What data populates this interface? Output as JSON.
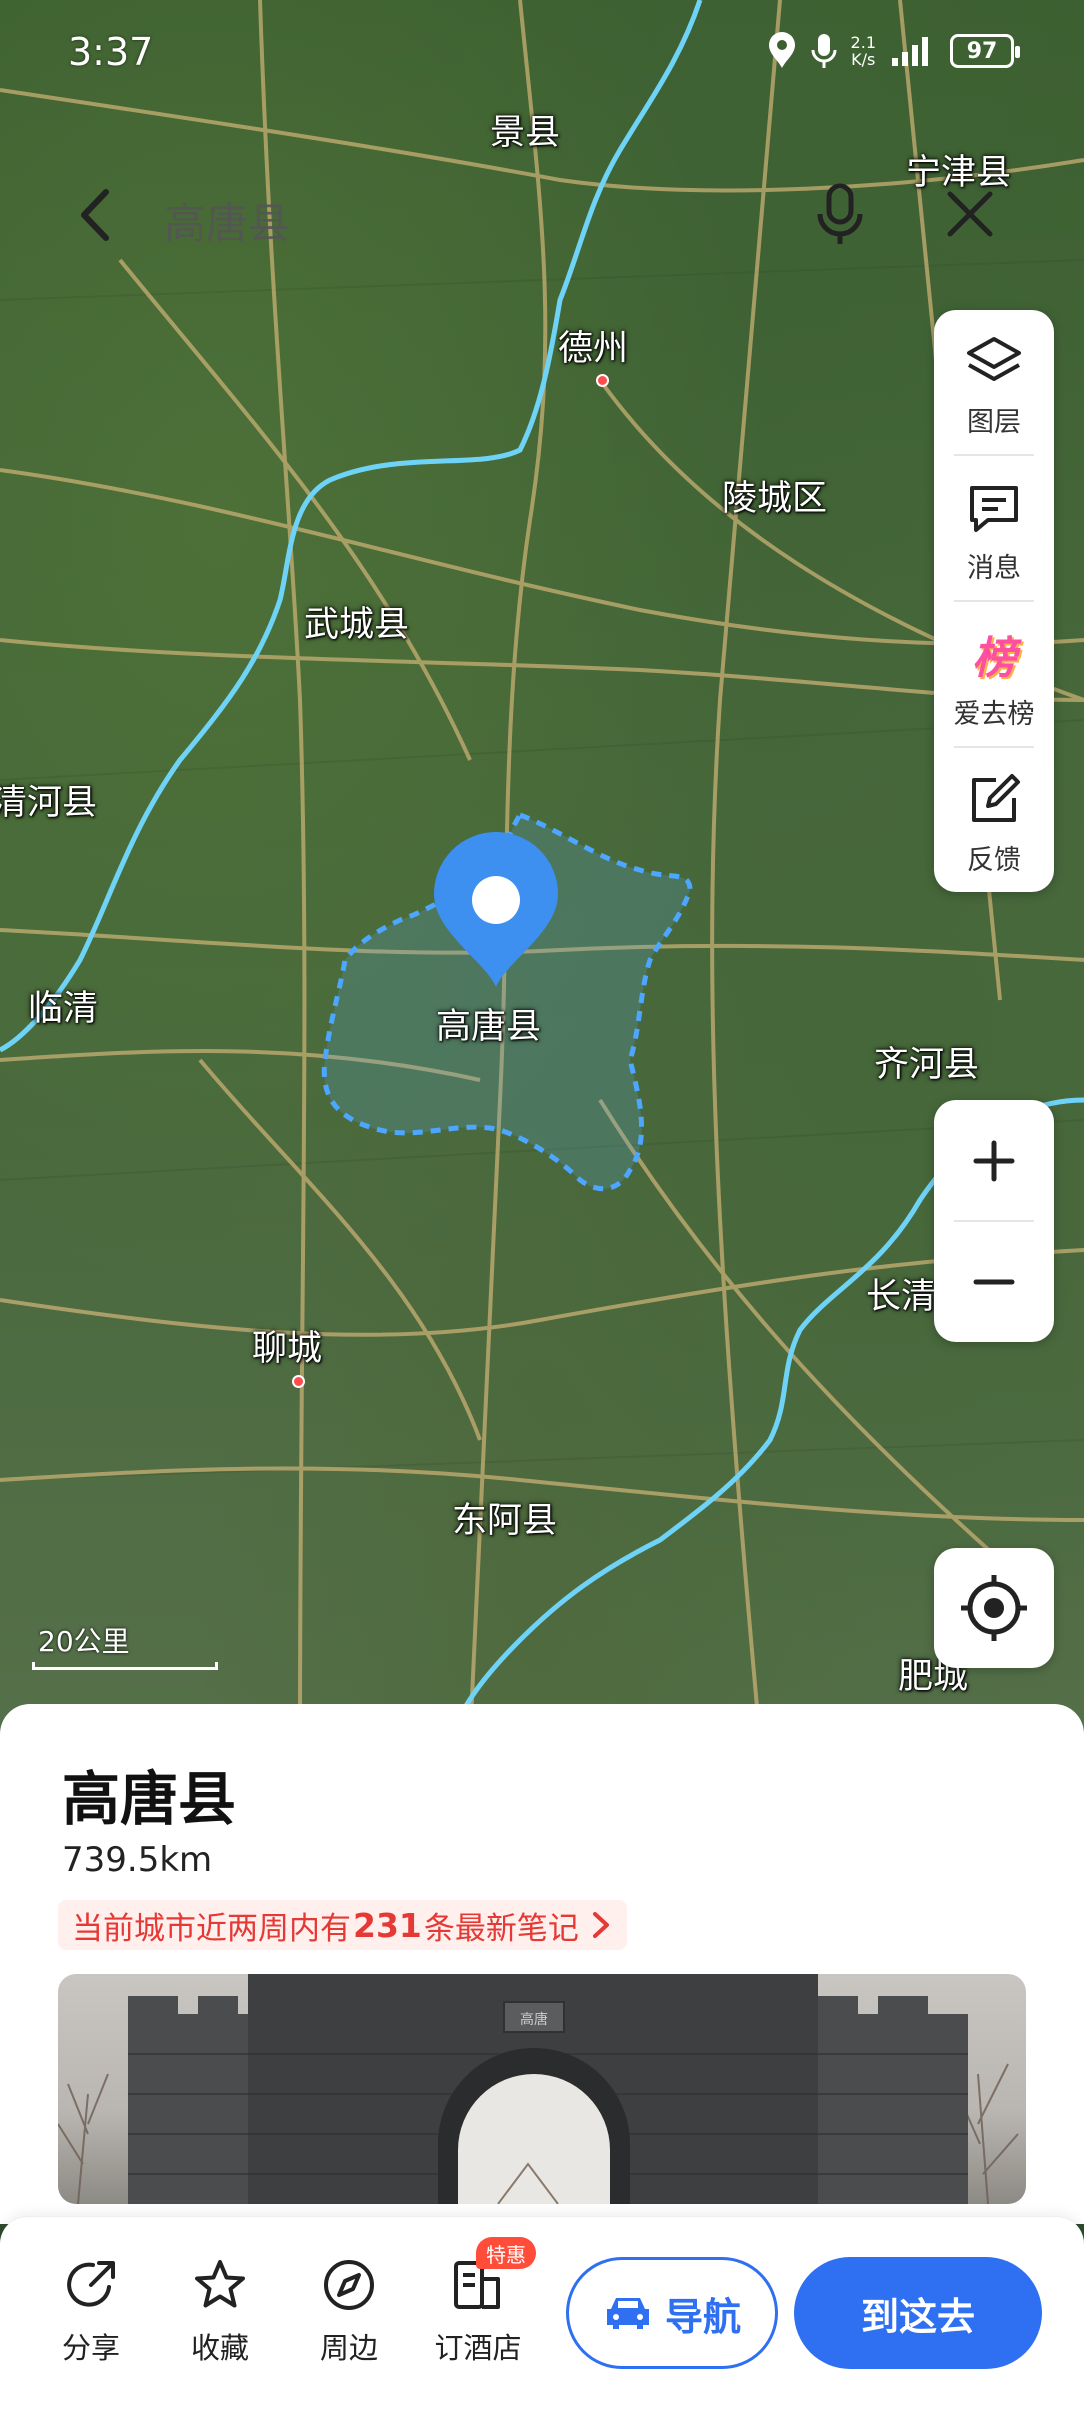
{
  "status_bar": {
    "time": "3:37",
    "net_speed_value": "2.1",
    "net_speed_unit": "K/s",
    "battery": "97"
  },
  "search": {
    "title": "高唐县"
  },
  "map": {
    "places": [
      {
        "name": "景县"
      },
      {
        "name": "宁津县"
      },
      {
        "name": "德州"
      },
      {
        "name": "陵城区"
      },
      {
        "name": "武城县"
      },
      {
        "name": "清河县"
      },
      {
        "name": "临清"
      },
      {
        "name": "高唐县"
      },
      {
        "name": "齐河县"
      },
      {
        "name": "长清"
      },
      {
        "name": "聊城"
      },
      {
        "name": "东阿县"
      },
      {
        "name": "肥城"
      }
    ],
    "scale_label": "20公里",
    "colors": {
      "river": "#6fd3f7",
      "boundary": "#4da6ff",
      "pin": "#3d8ff0",
      "road": "#c8b074"
    }
  },
  "tools": {
    "layers_label": "图层",
    "messages_label": "消息",
    "ranking_label": "爱去榜",
    "ranking_icon_char": "榜",
    "feedback_label": "反馈"
  },
  "place": {
    "title": "高唐县",
    "distance": "739.5km",
    "notes_prefix": "当前城市近两周内有",
    "notes_count": "231",
    "notes_suffix": "条最新笔记",
    "gate_plaque": "高唐"
  },
  "actions": {
    "share_label": "分享",
    "favorite_label": "收藏",
    "nearby_label": "周边",
    "hotel_label": "订酒店",
    "hotel_badge": "特惠",
    "navigate_label": "导航",
    "go_label": "到这去"
  },
  "accent_color": "#2f6ff2"
}
